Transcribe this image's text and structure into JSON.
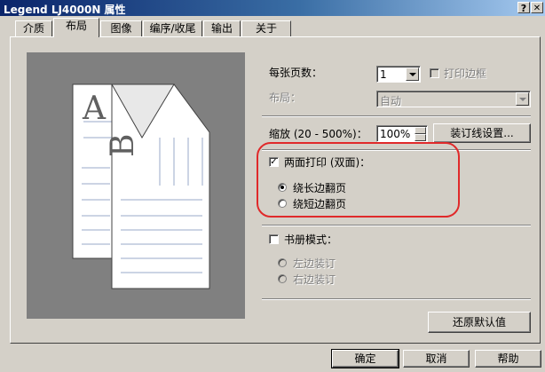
{
  "window": {
    "title": "Legend LJ4000N 属性",
    "help_button": "?",
    "close_button": "✕"
  },
  "tabs": [
    {
      "label": "介质"
    },
    {
      "label": "布局",
      "active": true
    },
    {
      "label": "图像"
    },
    {
      "label": "编序/收尾"
    },
    {
      "label": "输出"
    },
    {
      "label": "关于"
    }
  ],
  "preview": {
    "letter_front": "A",
    "letter_back": "B"
  },
  "pages_per_sheet": {
    "label": "每张页数：",
    "value": "1",
    "print_borders_label": "打印边框",
    "print_borders_checked": false,
    "print_borders_enabled": false
  },
  "layout": {
    "label": "布局：",
    "value": "自动",
    "enabled": false
  },
  "scale": {
    "label": "缩放 (20 - 500%)：",
    "value": "100%"
  },
  "binding_button": "装订线设置...",
  "duplex": {
    "label": "两面打印 (双面)：",
    "checked": true,
    "options": [
      {
        "label": "绕长边翻页",
        "selected": true
      },
      {
        "label": "绕短边翻页",
        "selected": false
      }
    ]
  },
  "booklet": {
    "label": "书册模式：",
    "checked": false,
    "options": [
      {
        "label": "左边装订",
        "enabled": false
      },
      {
        "label": "右边装订",
        "enabled": false
      }
    ]
  },
  "restore_defaults_button": "还原默认值",
  "footer": {
    "ok": "确定",
    "cancel": "取消",
    "help": "帮助"
  },
  "colors": {
    "highlight": "#e0292a",
    "titlebar_start": "#0a246a",
    "titlebar_end": "#a6caf0",
    "face": "#d4d0c8",
    "preview_bg": "#808080"
  }
}
